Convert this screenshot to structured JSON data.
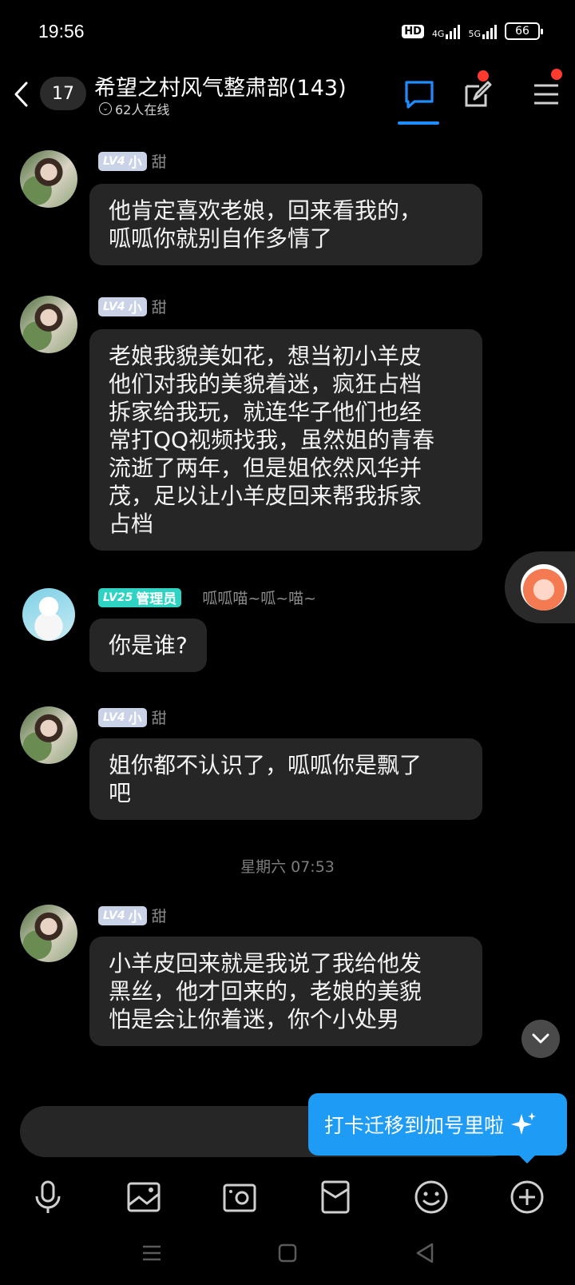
{
  "status_bar": {
    "time": "19:56",
    "hd_label": "HD",
    "net1": "4G",
    "net2": "5G",
    "battery": "66"
  },
  "header": {
    "unread_count": "17",
    "group_title": "希望之村风气整肃部(143)",
    "online_text": "62人在线",
    "accent_color": "#1e8dff"
  },
  "messages": [
    {
      "level": "LV4",
      "title": "小",
      "nickname": "甜",
      "text_lines": [
        "他肯定喜欢老娘，回来看我的，",
        "呱呱你就别自作多情了"
      ]
    },
    {
      "level": "LV4",
      "title": "小",
      "nickname": "甜",
      "text_lines": [
        "老娘我貌美如花，想当初小羊皮",
        "他们对我的美貌着迷，疯狂占档",
        "拆家给我玩，就连华子他们也经",
        "常打QQ视频找我，虽然姐的青春",
        "流逝了两年，但是姐依然风华并",
        "茂，足以让小羊皮回来帮我拆家",
        "占档"
      ]
    },
    {
      "level": "LV25",
      "title": "管理员",
      "nickname": "呱呱喵~呱~喵~",
      "text_lines": [
        "你是谁?"
      ]
    },
    {
      "level": "LV4",
      "title": "小",
      "nickname": "甜",
      "text_lines": [
        "姐你都不认识了，呱呱你是飘了",
        "吧"
      ]
    },
    {
      "level": "LV4",
      "title": "小",
      "nickname": "甜",
      "text_lines": [
        "小羊皮回来就是我说了我给他发",
        "黑丝，他才回来的，老娘的美貌",
        "怕是会让你着迷，你个小处男"
      ]
    }
  ],
  "timestamp": "星期六 07:53",
  "tip_popup": {
    "text": "打卡迁移到加号里啦",
    "color": "#1d9bf5"
  },
  "toolbar": {
    "icons": [
      "microphone-icon",
      "image-icon",
      "camera-icon",
      "red-packet-icon",
      "emoji-icon",
      "plus-icon"
    ]
  },
  "navbar": {
    "icons": [
      "menu-icon",
      "home-icon",
      "back-icon"
    ]
  }
}
